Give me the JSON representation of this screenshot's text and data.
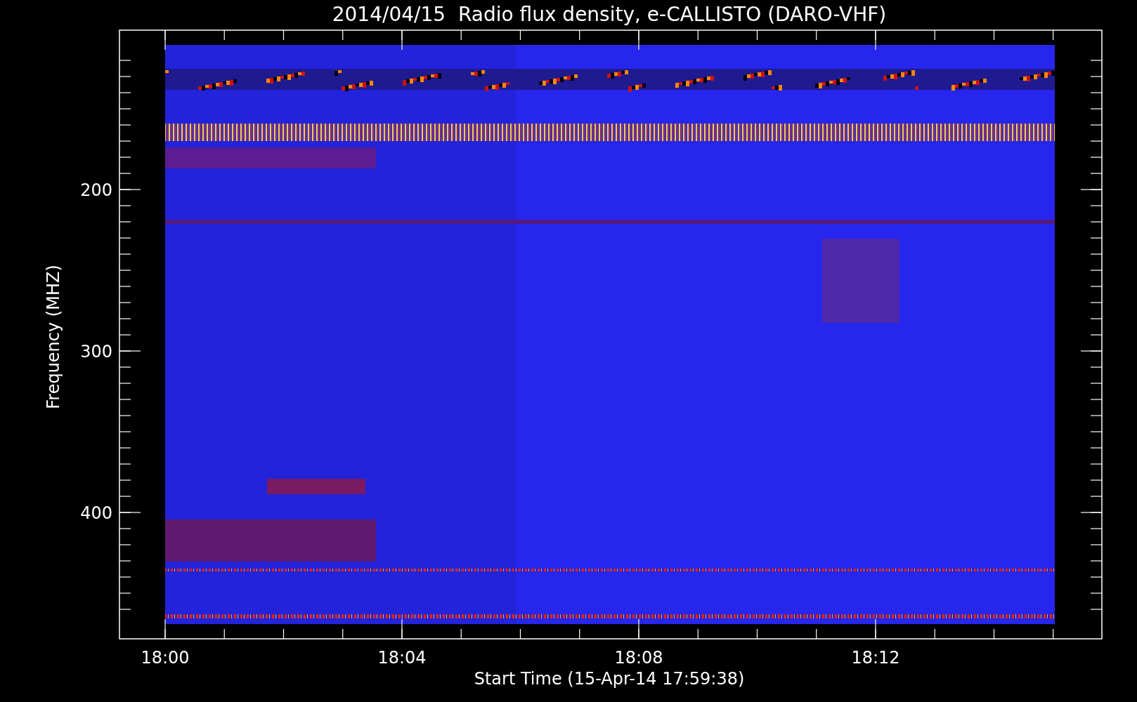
{
  "title": "2014/04/15  Radio flux density, e-CALLISTO (DARO-VHF)",
  "y_axis": {
    "label": "Frequency (MHZ)",
    "ticks": [
      "200",
      "300",
      "400"
    ]
  },
  "x_axis": {
    "label": "Start Time (15-Apr-14 17:59:38)",
    "ticks": [
      "18:00",
      "18:04",
      "18:08",
      "18:12"
    ]
  }
}
